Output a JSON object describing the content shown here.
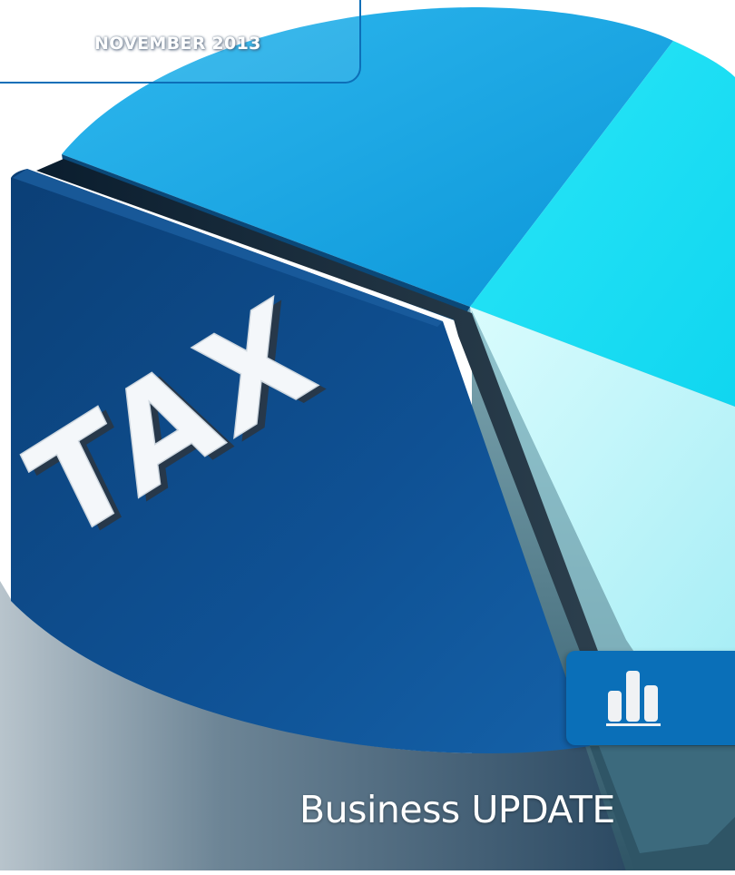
{
  "header": {
    "date": "NOVEMBER 2013"
  },
  "hero": {
    "pie_label": "TAX",
    "icon": "bar-chart-icon"
  },
  "footer": {
    "subtitle": "Business UPDATE"
  },
  "colors": {
    "brand_blue": "#0a6fb8",
    "navy_slice": "#0d4a86",
    "sky_slice": "#0aa6e6",
    "cyan_slice": "#19def4",
    "pale_slice": "#bff7fb"
  }
}
